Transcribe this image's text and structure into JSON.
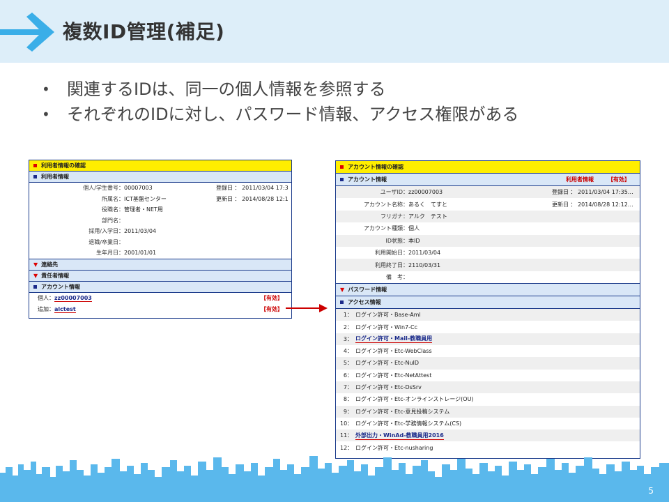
{
  "slide": {
    "title": "複数ID管理(補足)",
    "bullets": [
      "関連するIDは、同一の個人情報を参照する",
      "それぞれのIDに対し、パスワード情報、アクセス権限がある"
    ],
    "page_number": "5"
  },
  "left_panel": {
    "confirm_title": "利用者情報の確認",
    "user_info_title": "利用者情報",
    "fields": [
      {
        "label": "個人/学生番号：",
        "value": "00007003"
      },
      {
        "label": "所属名：",
        "value": "ICT基盤センター"
      },
      {
        "label": "役職名：",
        "value": "管理者・NET用"
      },
      {
        "label": "部門名：",
        "value": ""
      },
      {
        "label": "採用/入学日：",
        "value": "2011/03/04"
      },
      {
        "label": "退職/卒業日：",
        "value": ""
      },
      {
        "label": "生年月日：",
        "value": "2001/01/01"
      }
    ],
    "registered": "登録日 ： 2011/03/04 17:3…",
    "updated": "更新日 ： 2014/08/28 12:1…",
    "contact_title": "連絡先",
    "responsible_title": "責任者情報",
    "account_info_title": "アカウント情報",
    "accounts": [
      {
        "label": "個人：",
        "id": "zz00007003",
        "status": "【有効】"
      },
      {
        "label": "追加：",
        "id": "alctest",
        "status": "【有効】"
      }
    ]
  },
  "right_panel": {
    "confirm_title": "アカウント情報の確認",
    "account_info_title": "アカウント情報",
    "user_info_link": "利用者情報",
    "status": "【有効】",
    "fields": [
      {
        "label": "ユーザID：",
        "value": "zz00007003"
      },
      {
        "label": "アカウント名称：",
        "value": "あるく　てすと"
      },
      {
        "label": "フリガナ：",
        "value": "アルク　テスト"
      },
      {
        "label": "アカウント種類：",
        "value": "個人"
      },
      {
        "label": "ID状態：",
        "value": "本ID"
      },
      {
        "label": "利用開始日：",
        "value": "2011/03/04"
      },
      {
        "label": "利用終了日：",
        "value": "2110/03/31"
      },
      {
        "label": "備　考：",
        "value": ""
      }
    ],
    "registered": "登録日 ： 2011/03/04 17:35…",
    "updated": "更新日 ： 2014/08/28 12:12…",
    "password_title": "パスワード情報",
    "access_title": "アクセス情報",
    "access_list": [
      {
        "num": "1：",
        "text": "ログイン許可・Base-Aml"
      },
      {
        "num": "2：",
        "text": "ログイン許可・Win7-Cc"
      },
      {
        "num": "3：",
        "text": "ログイン許可・Mail-教職員用"
      },
      {
        "num": "4：",
        "text": "ログイン許可・Etc-WebClass"
      },
      {
        "num": "5：",
        "text": "ログイン許可・Etc-NuID"
      },
      {
        "num": "6：",
        "text": "ログイン許可・Etc-NetAttest"
      },
      {
        "num": "7：",
        "text": "ログイン許可・Etc-DsSrv"
      },
      {
        "num": "8：",
        "text": "ログイン許可・Etc-オンラインストレージ(OU)"
      },
      {
        "num": "9：",
        "text": "ログイン許可・Etc-意見投稿システム"
      },
      {
        "num": "10：",
        "text": "ログイン許可・Etc-学務情報システム(CS)"
      },
      {
        "num": "11：",
        "text": "外部出力・WinAd-教職員用2016"
      },
      {
        "num": "12：",
        "text": "ログイン許可・Etc-nusharing"
      }
    ]
  },
  "colors": {
    "header_band": "#ddeef9",
    "accent_blue": "#3aaee8",
    "panel_border": "#1a3a8a",
    "yellow_bar": "#ffee00",
    "status_red": "#cc0000",
    "skyline": "#5ab8ec"
  },
  "icons": [
    "arrow-right-icon",
    "red-arrow-icon",
    "red-square-icon",
    "navy-square-icon",
    "red-triangle-icon"
  ]
}
